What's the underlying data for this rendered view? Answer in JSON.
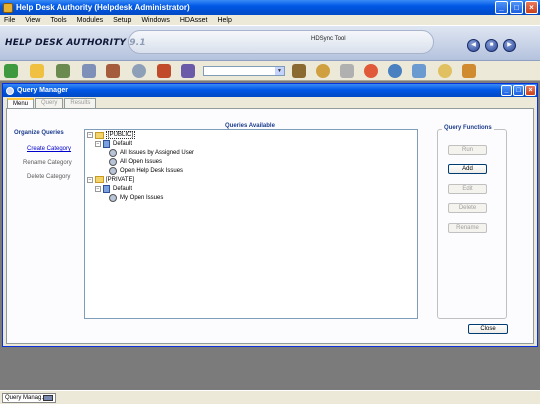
{
  "window": {
    "title": "Help Desk Authority (Helpdesk Administrator)"
  },
  "menu": {
    "items": [
      {
        "label": "File"
      },
      {
        "label": "View"
      },
      {
        "label": "Tools"
      },
      {
        "label": "Modules"
      },
      {
        "label": "Setup"
      },
      {
        "label": "Windows"
      },
      {
        "label": "HDAsset"
      },
      {
        "label": "Help"
      }
    ]
  },
  "banner": {
    "brand": "HELP DESK AUTHORITY",
    "version": "9.1",
    "hdsync": "HDSync Tool"
  },
  "toolbar": {
    "combo_value": "",
    "icons_left": [
      "refresh-icon",
      "folder-open-icon",
      "people-icon",
      "list-icon",
      "report-icon",
      "search-icon",
      "books-icon",
      "chart-icon"
    ],
    "icons_right": [
      "calendar-icon",
      "globe-icon",
      "wand-icon",
      "lifebuoy-icon",
      "network-icon",
      "notes-icon",
      "clock-icon",
      "flag-icon"
    ]
  },
  "child": {
    "title": "Query Manager",
    "tabs": [
      {
        "label": "Menu",
        "active": true
      },
      {
        "label": "Query",
        "active": false
      },
      {
        "label": "Results",
        "active": false
      }
    ],
    "organize": {
      "heading": "Organize Queries",
      "create": "Create Category",
      "rename": "Rename Category",
      "delete": "Delete Category"
    },
    "queries_heading": "Queries Available",
    "tree": {
      "public": "[PUBLIC]",
      "public_default": "Default",
      "public_items": [
        "All Issues by Assigned User",
        "All Open Issues",
        "Open Help Desk Issues"
      ],
      "private": "[PRIVATE]",
      "private_default": "Default",
      "private_items": [
        "My Open Issues"
      ]
    },
    "functions": {
      "heading": "Query Functions",
      "run": "Run",
      "add": "Add",
      "edit": "Edit",
      "delete": "Delete",
      "rename": "Rename"
    },
    "close": "Close"
  },
  "taskbar": {
    "item": "Query Manag..."
  }
}
